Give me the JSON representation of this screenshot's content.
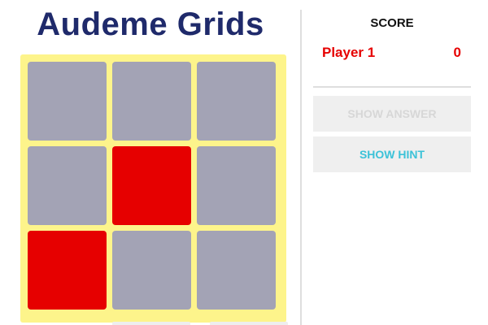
{
  "title": "Audeme Grids",
  "board": {
    "rows": 3,
    "cols": 3,
    "cells": [
      {
        "row": 1,
        "col": 1,
        "lit": false
      },
      {
        "row": 1,
        "col": 2,
        "lit": false
      },
      {
        "row": 1,
        "col": 3,
        "lit": false
      },
      {
        "row": 2,
        "col": 1,
        "lit": false
      },
      {
        "row": 2,
        "col": 2,
        "lit": true
      },
      {
        "row": 2,
        "col": 3,
        "lit": false
      },
      {
        "row": 3,
        "col": 1,
        "lit": true
      },
      {
        "row": 3,
        "col": 2,
        "lit": false
      },
      {
        "row": 3,
        "col": 3,
        "lit": false
      }
    ],
    "colors": {
      "frame": "#fdf48b",
      "off": "#a3a3b5",
      "on": "#e60000"
    }
  },
  "score": {
    "heading": "SCORE",
    "players": [
      {
        "name": "Player 1",
        "points": "0",
        "color": "#e60000"
      }
    ]
  },
  "buttons": {
    "show_answer": "SHOW ANSWER",
    "show_hint": "SHOW HINT",
    "show_answer_enabled": false,
    "hint_color": "#3cc2d8"
  }
}
